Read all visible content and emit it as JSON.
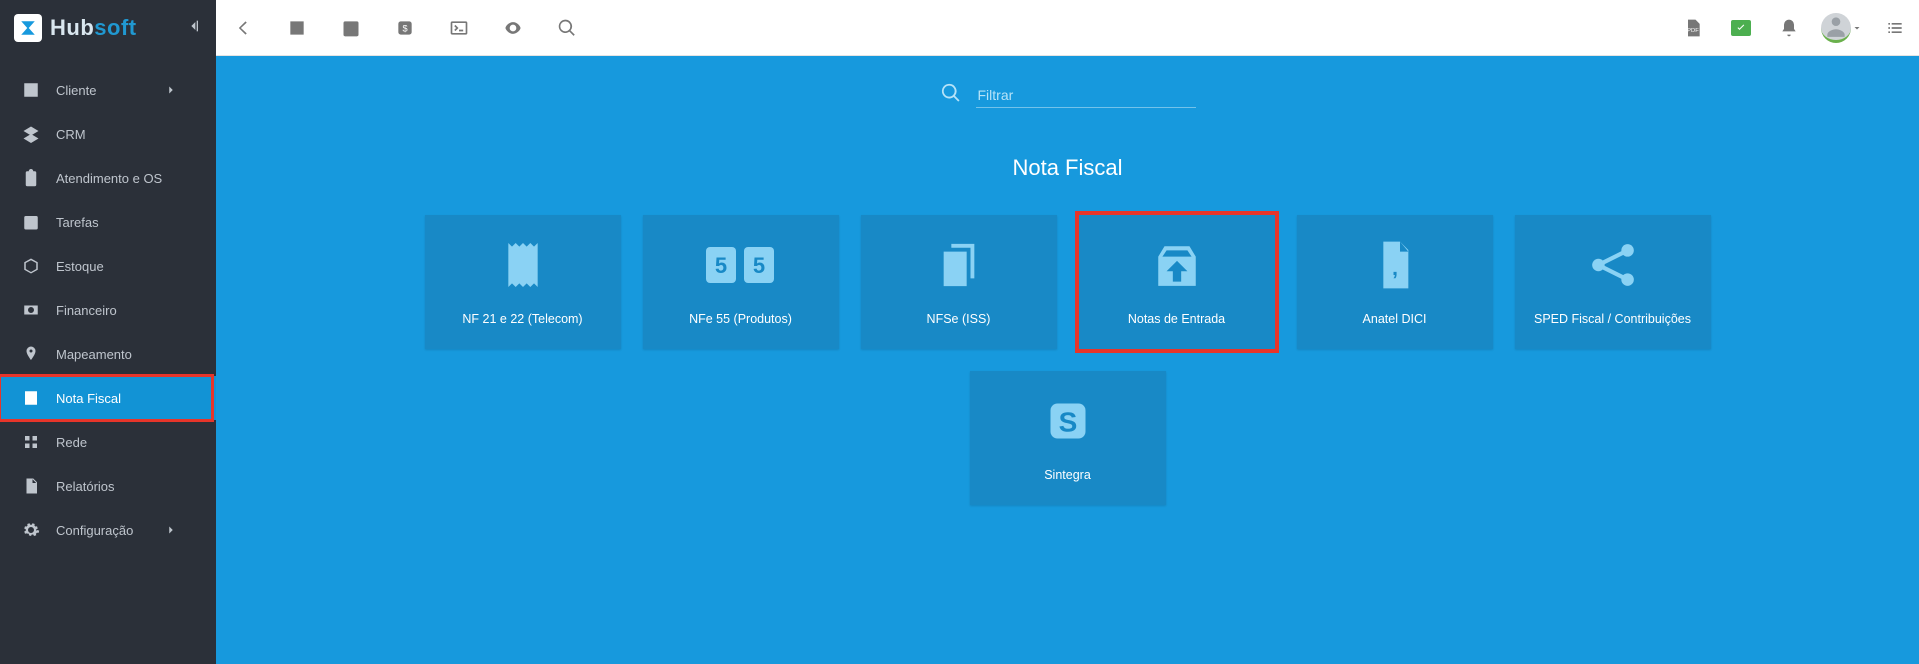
{
  "brand": {
    "name1": "Hub",
    "name2": "soft"
  },
  "sidebar": {
    "items": [
      {
        "label": "Cliente",
        "icon": "account-box",
        "chev": true
      },
      {
        "label": "CRM",
        "icon": "layers"
      },
      {
        "label": "Atendimento e OS",
        "icon": "clipboard"
      },
      {
        "label": "Tarefas",
        "icon": "calendar"
      },
      {
        "label": "Estoque",
        "icon": "cube"
      },
      {
        "label": "Financeiro",
        "icon": "cash"
      },
      {
        "label": "Mapeamento",
        "icon": "map-pin"
      },
      {
        "label": "Nota Fiscal",
        "icon": "doc-lines",
        "active": true,
        "highlighted": true
      },
      {
        "label": "Rede",
        "icon": "network"
      },
      {
        "label": "Relatórios",
        "icon": "doc"
      },
      {
        "label": "Configuração",
        "icon": "gear",
        "chev": true
      }
    ]
  },
  "search": {
    "placeholder": "Filtrar"
  },
  "page": {
    "title": "Nota Fiscal"
  },
  "tiles": [
    {
      "label": "NF 21 e 22 (Telecom)",
      "icon": "receipt"
    },
    {
      "label": "NFe 55 (Produtos)",
      "icon": "double5"
    },
    {
      "label": "NFSe (ISS)",
      "icon": "copies"
    },
    {
      "label": "Notas de Entrada",
      "icon": "upload-box",
      "highlighted": true
    },
    {
      "label": "Anatel DICI",
      "icon": "doc-comma"
    },
    {
      "label": "SPED Fiscal / Contribuições",
      "icon": "share"
    },
    {
      "label": "Sintegra",
      "icon": "s-box"
    }
  ]
}
